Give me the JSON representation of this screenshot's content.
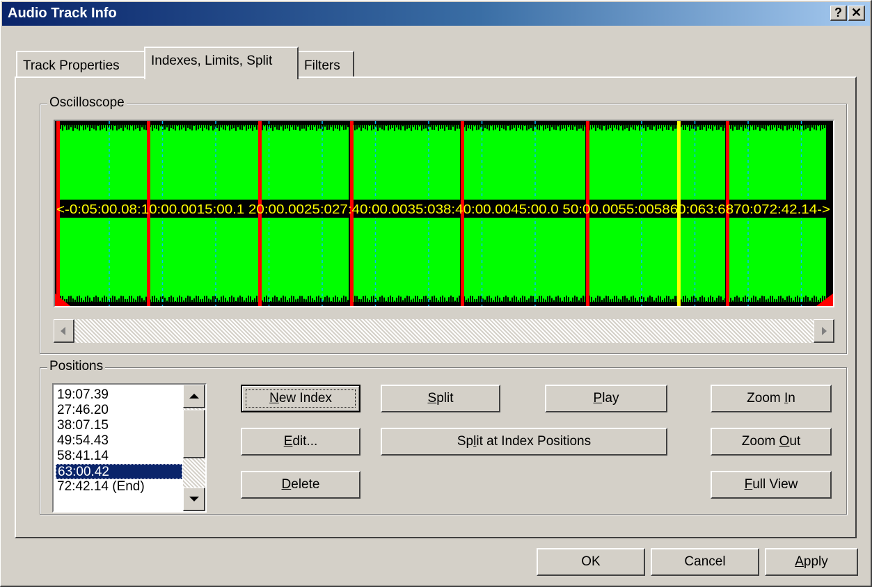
{
  "window": {
    "title": "Audio Track Info",
    "help_glyph": "?",
    "close_glyph": "✕"
  },
  "tabs": [
    {
      "label": "Track Properties",
      "active": false
    },
    {
      "label": "Indexes, Limits, Split",
      "active": true
    },
    {
      "label": "Filters",
      "active": false
    }
  ],
  "oscilloscope": {
    "group_label": "Oscilloscope",
    "time_labels": "<-0:05:00.08:10:00.0015:00.1 20:00.0025:027:40:00.0035:038:40:00.0045:00.0 50:00.0055:005860:063:6870:072:42.14->",
    "colors": {
      "wave": "#00ff00",
      "index_marker": "#ff0000",
      "selected_marker": "#ffff00",
      "grid": "#00c0ff",
      "label": "#ffff00"
    }
  },
  "positions": {
    "group_label": "Positions",
    "items": [
      "19:07.39",
      "27:46.20",
      "38:07.15",
      "49:54.43",
      "58:41.14",
      "63:00.42",
      "72:42.14 (End)"
    ],
    "selected_index": 5
  },
  "buttons": {
    "new_index": {
      "pre": "",
      "key": "N",
      "post": "ew Index"
    },
    "edit": {
      "pre": "",
      "key": "E",
      "post": "dit..."
    },
    "delete": {
      "pre": "",
      "key": "D",
      "post": "elete"
    },
    "split": {
      "pre": "",
      "key": "S",
      "post": "plit"
    },
    "split_at_index": {
      "pre": "Sp",
      "key": "l",
      "post": "it at Index Positions"
    },
    "play": {
      "pre": "",
      "key": "P",
      "post": "lay"
    },
    "zoom_in": {
      "pre": "Zoom ",
      "key": "I",
      "post": "n"
    },
    "zoom_out": {
      "pre": "Zoom ",
      "key": "O",
      "post": "ut"
    },
    "full_view": {
      "pre": "",
      "key": "F",
      "post": "ull View"
    }
  },
  "footer": {
    "ok": "OK",
    "cancel": "Cancel",
    "apply": {
      "pre": "",
      "key": "A",
      "post": "pply"
    }
  }
}
